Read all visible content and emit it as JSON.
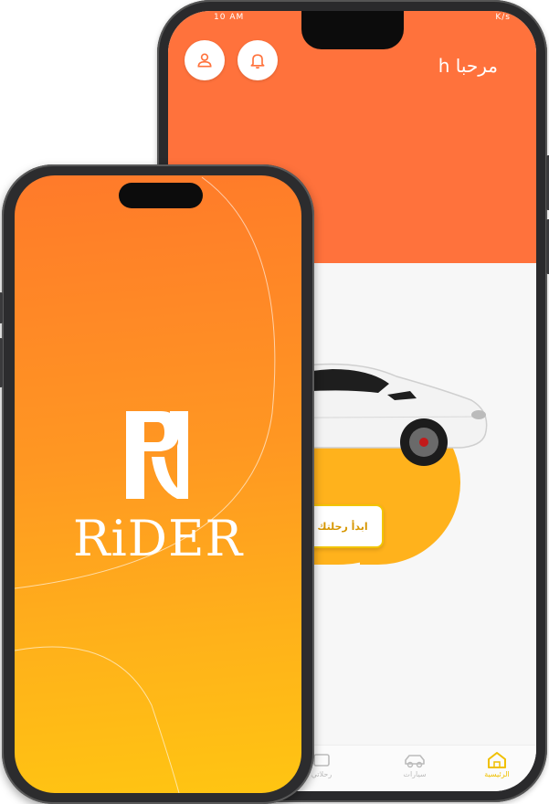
{
  "back_phone": {
    "status_left": "10 AM",
    "status_right": "K/s",
    "greeting": "مرحبا h",
    "start_button_label": "ابدأ رحلتك",
    "nav": {
      "home_label": "الرئيسية",
      "cars_label": "سيارات",
      "trips_label": "رحلاتي"
    },
    "icons": [
      "user-icon",
      "bell-icon",
      "home-icon",
      "car-icon"
    ]
  },
  "front_phone": {
    "brand_name": "RiDER",
    "logo_letter": "R"
  },
  "colors": {
    "header_orange": "#ff723c",
    "accent_yellow": "#ffb21c",
    "button_border": "#f2c400",
    "splash_gradient_top": "#ff7a2a",
    "splash_gradient_bottom": "#ffc512"
  }
}
